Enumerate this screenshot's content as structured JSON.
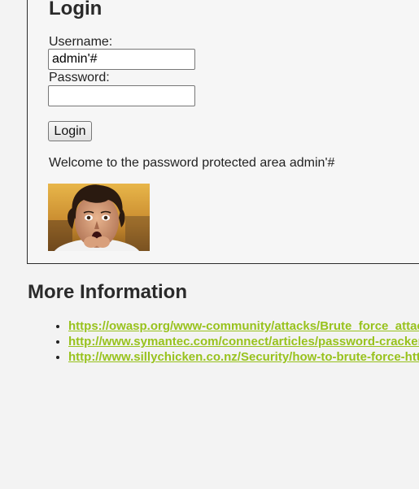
{
  "login": {
    "title": "Login",
    "username_label": "Username:",
    "username_value": "admin'#",
    "password_label": "Password:",
    "password_value": "",
    "button_label": "Login",
    "welcome_message": "Welcome to the password protected area admin'#"
  },
  "more_info": {
    "title": "More Information",
    "links": [
      "https://owasp.org/www-community/attacks/Brute_force_attack",
      "http://www.symantec.com/connect/articles/password-crackers-ensuring-security-your-password",
      "http://www.sillychicken.co.nz/Security/how-to-brute-force-http-forms-in-windows.html"
    ]
  },
  "colors": {
    "link": "#98c21d",
    "background": "#f3f3f3"
  }
}
